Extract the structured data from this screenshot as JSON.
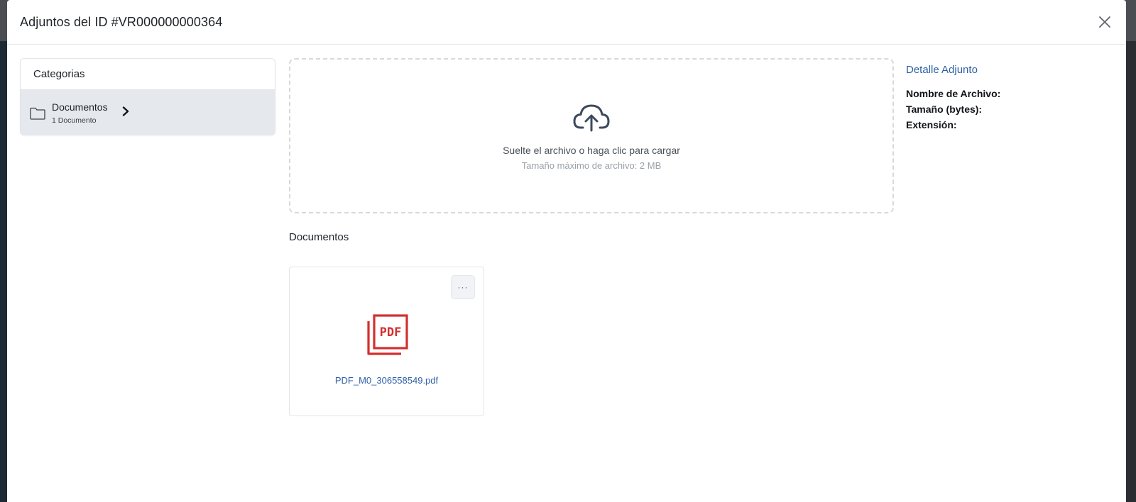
{
  "modal": {
    "title": "Adjuntos del ID #VR000000000364"
  },
  "sidebar": {
    "title": "Categorias",
    "items": [
      {
        "label": "Documentos",
        "count": "1 Documento",
        "icon": "folder-icon"
      }
    ]
  },
  "dropzone": {
    "primary": "Suelte el archivo o haga clic para cargar",
    "secondary": "Tamaño máximo de archivo: 2 MB",
    "icon": "cloud-upload-icon"
  },
  "files": {
    "section_title": "Documentos",
    "items": [
      {
        "name": "PDF_M0_306558549.pdf",
        "icon": "pdf-icon",
        "menu_label": "···"
      }
    ]
  },
  "detail": {
    "title": "Detalle Adjunto",
    "file_name_label": "Nombre de Archivo:",
    "size_label": "Tamaño (bytes):",
    "extension_label": "Extensión:"
  },
  "colors": {
    "accent": "#2d5fa8",
    "pdf_red": "#d32f2f",
    "selected_bg": "#e5e8ec"
  }
}
